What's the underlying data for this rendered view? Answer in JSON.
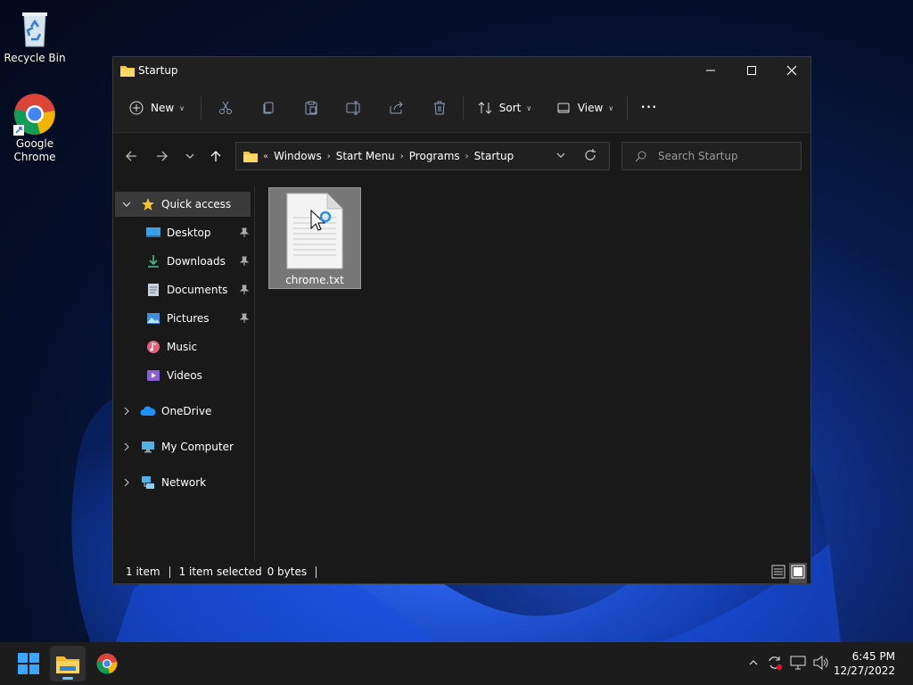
{
  "desktop": {
    "icons": [
      {
        "label": "Recycle Bin"
      },
      {
        "label": "Google\nChrome"
      }
    ]
  },
  "window": {
    "title": "Startup",
    "toolbar": {
      "new_label": "New",
      "sort_label": "Sort",
      "view_label": "View",
      "more_label": "•••"
    },
    "address": {
      "overflow": "«",
      "segments": [
        "Windows",
        "Start Menu",
        "Programs",
        "Startup"
      ]
    },
    "search": {
      "placeholder": "Search Startup"
    },
    "sidebar": {
      "items": [
        {
          "label": "Quick access",
          "icon": "star-icon"
        },
        {
          "label": "Desktop",
          "icon": "desktop-folder-icon",
          "pinned": true
        },
        {
          "label": "Downloads",
          "icon": "download-icon",
          "pinned": true
        },
        {
          "label": "Documents",
          "icon": "documents-icon",
          "pinned": true
        },
        {
          "label": "Pictures",
          "icon": "pictures-icon",
          "pinned": true
        },
        {
          "label": "Music",
          "icon": "music-icon"
        },
        {
          "label": "Videos",
          "icon": "videos-icon"
        },
        {
          "label": "OneDrive",
          "icon": "cloud-icon"
        },
        {
          "label": "My Computer",
          "icon": "computer-icon"
        },
        {
          "label": "Network",
          "icon": "network-icon"
        }
      ]
    },
    "files": [
      {
        "name": "chrome.txt",
        "icon": "text-file-icon"
      }
    ],
    "status": {
      "count": "1 item",
      "selected": "1 item selected",
      "size": "0 bytes"
    }
  },
  "taskbar": {
    "clock_time": "6:45 PM",
    "clock_date": "12/27/2022"
  },
  "colors": {
    "window_bg": "#191919",
    "toolbar_bg": "#202020",
    "selection": "#777777",
    "accent": "#60cdff"
  }
}
